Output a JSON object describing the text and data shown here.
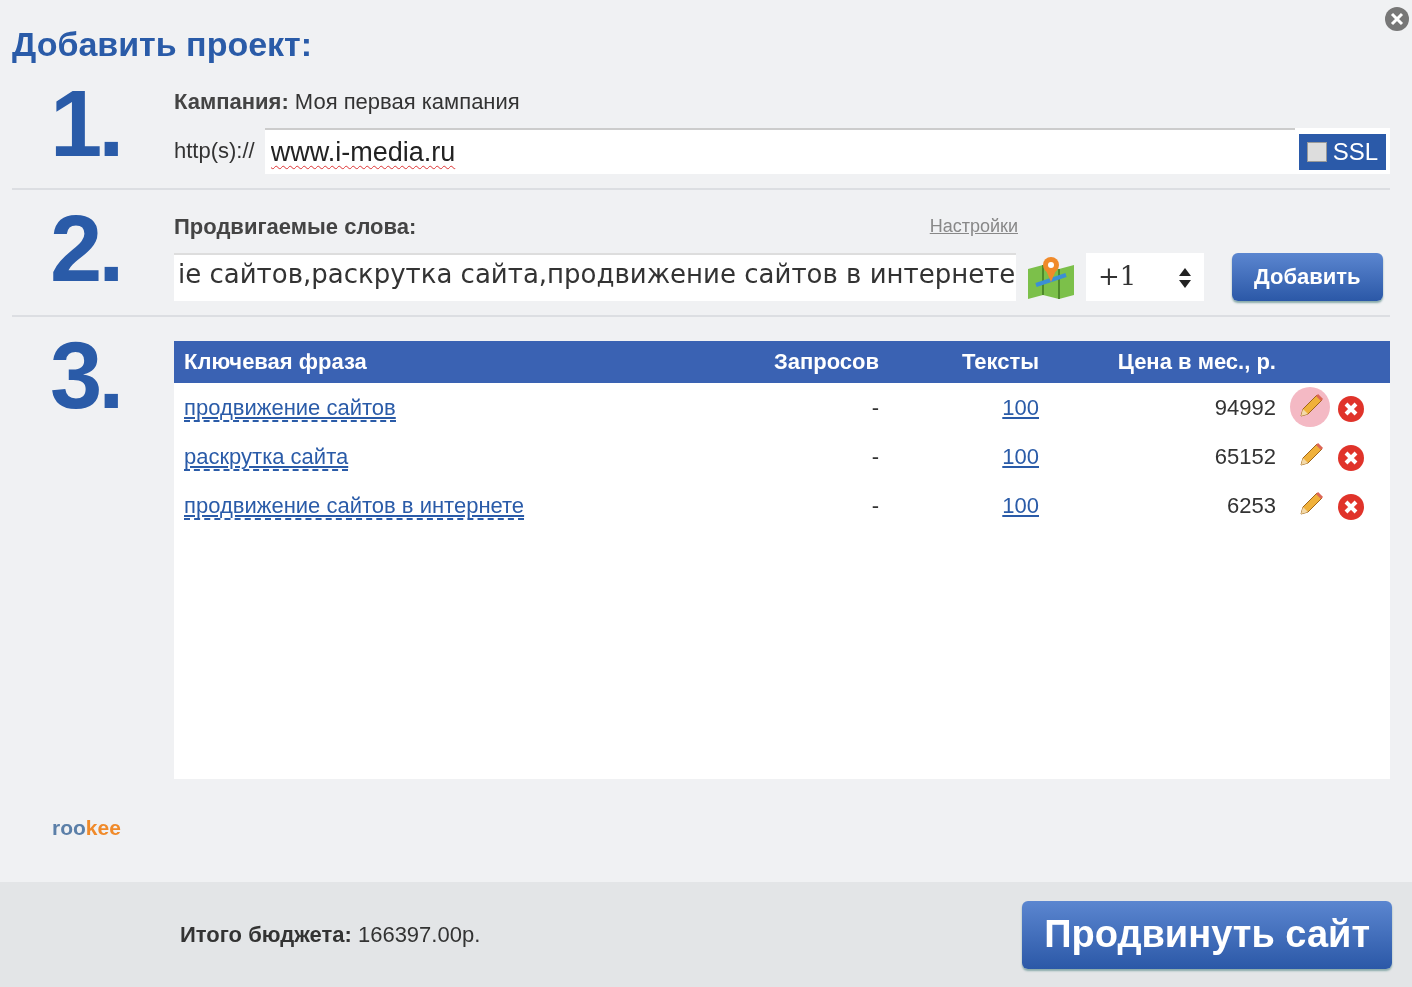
{
  "title": "Добавить проект:",
  "step1": {
    "number": "1.",
    "label": "Кампания:",
    "value": "Моя первая кампания",
    "prefix": "http(s)://",
    "url": "www.i-media.ru",
    "ssl": {
      "label": "SSL",
      "checked": false
    }
  },
  "step2": {
    "number": "2.",
    "label": "Продвигаемые слова:",
    "settings_link": "Настройки",
    "keywords": "іе сайтов,раскрутка сайта,продвижение сайтов в интернете",
    "spinner": "+1",
    "add_button": "Добавить"
  },
  "step3": {
    "number": "3.",
    "table": {
      "columns": [
        "Ключевая фраза",
        "Запросов",
        "Тексты",
        "Цена в мес., р."
      ],
      "rows": [
        {
          "phrase": "продвижение сайтов",
          "requests": "-",
          "texts": "100",
          "price": "94992",
          "highlighted": true
        },
        {
          "phrase": "раскрутка сайта",
          "requests": "-",
          "texts": "100",
          "price": "65152",
          "highlighted": false
        },
        {
          "phrase": "продвижение сайтов в интернете",
          "requests": "-",
          "texts": "100",
          "price": "6253",
          "highlighted": false
        }
      ]
    }
  },
  "logo": [
    "roo",
    "kee"
  ],
  "footer": {
    "budget_label": "Итого бюджета:",
    "budget_value": "166397.00р.",
    "submit_button": "Продвинуть сайт"
  }
}
